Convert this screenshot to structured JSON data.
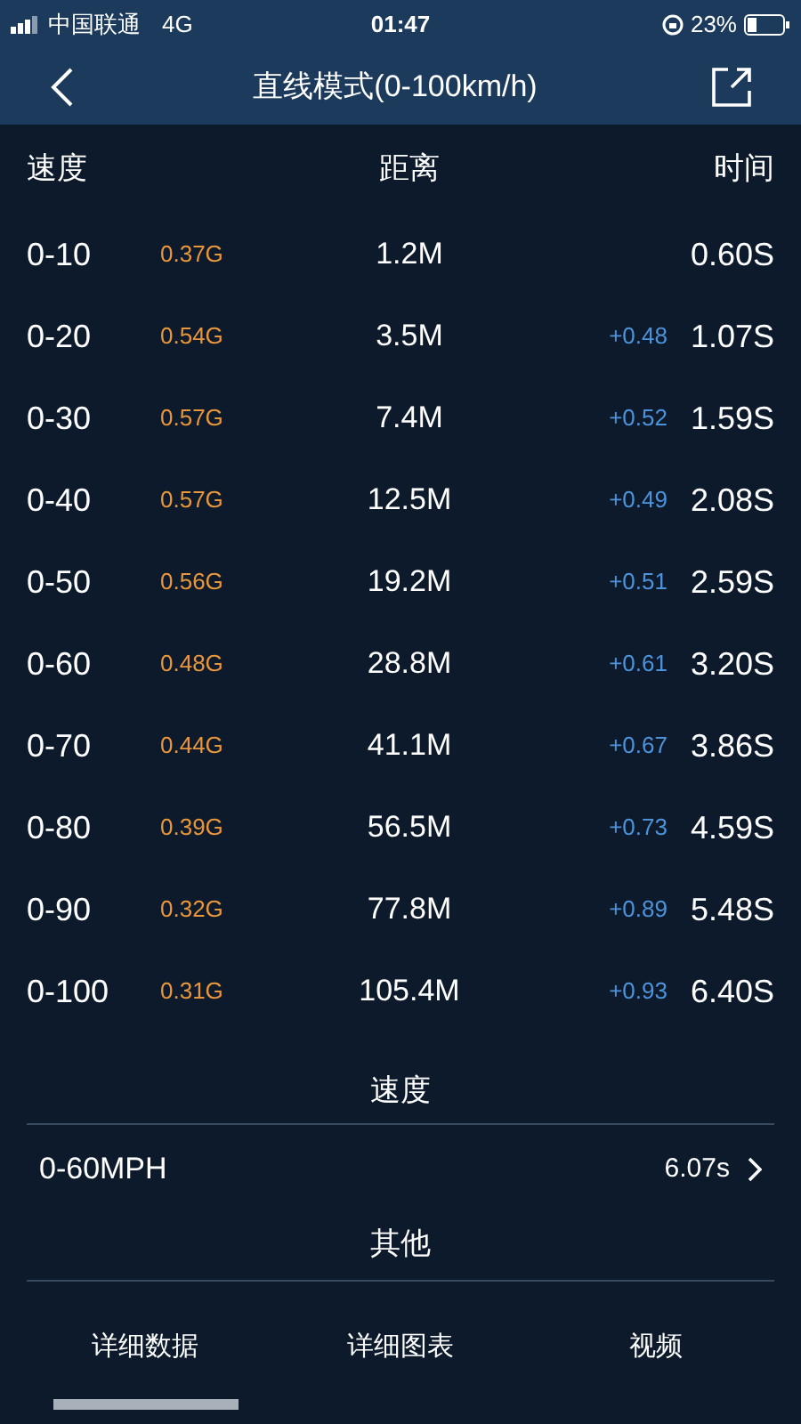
{
  "status_bar": {
    "carrier": "中国联通",
    "network": "4G",
    "time": "01:47",
    "battery": "23%"
  },
  "nav": {
    "title": "直线模式(0-100km/h)"
  },
  "table": {
    "columns": [
      "速度",
      "距离",
      "时间"
    ],
    "rows": [
      {
        "speed": "0-10",
        "g": "0.37G",
        "distance": "1.2M",
        "time": "0.60S"
      },
      {
        "speed": "0-20",
        "g": "0.54G",
        "distance": "3.5M",
        "delta": "+0.48",
        "time": "1.07S"
      },
      {
        "speed": "0-30",
        "g": "0.57G",
        "distance": "7.4M",
        "delta": "+0.52",
        "time": "1.59S"
      },
      {
        "speed": "0-40",
        "g": "0.57G",
        "distance": "12.5M",
        "delta": "+0.49",
        "time": "2.08S"
      },
      {
        "speed": "0-50",
        "g": "0.56G",
        "distance": "19.2M",
        "delta": "+0.51",
        "time": "2.59S"
      },
      {
        "speed": "0-60",
        "g": "0.48G",
        "distance": "28.8M",
        "delta": "+0.61",
        "time": "3.20S"
      },
      {
        "speed": "0-70",
        "g": "0.44G",
        "distance": "41.1M",
        "delta": "+0.67",
        "time": "3.86S"
      },
      {
        "speed": "0-80",
        "g": "0.39G",
        "distance": "56.5M",
        "delta": "+0.73",
        "time": "4.59S"
      },
      {
        "speed": "0-90",
        "g": "0.32G",
        "distance": "77.8M",
        "delta": "+0.89",
        "time": "5.48S"
      },
      {
        "speed": "0-100",
        "g": "0.31G",
        "distance": "105.4M",
        "delta": "+0.93",
        "time": "6.40S"
      }
    ]
  },
  "speed_section": {
    "title": "速度",
    "rows": [
      {
        "label": "0-60MPH",
        "value": "6.07s"
      }
    ]
  },
  "other_section": {
    "title": "其他"
  },
  "tabs": [
    {
      "label": "详细数据",
      "selected": true
    },
    {
      "label": "详细图表",
      "selected": false
    },
    {
      "label": "视频",
      "selected": false
    }
  ]
}
